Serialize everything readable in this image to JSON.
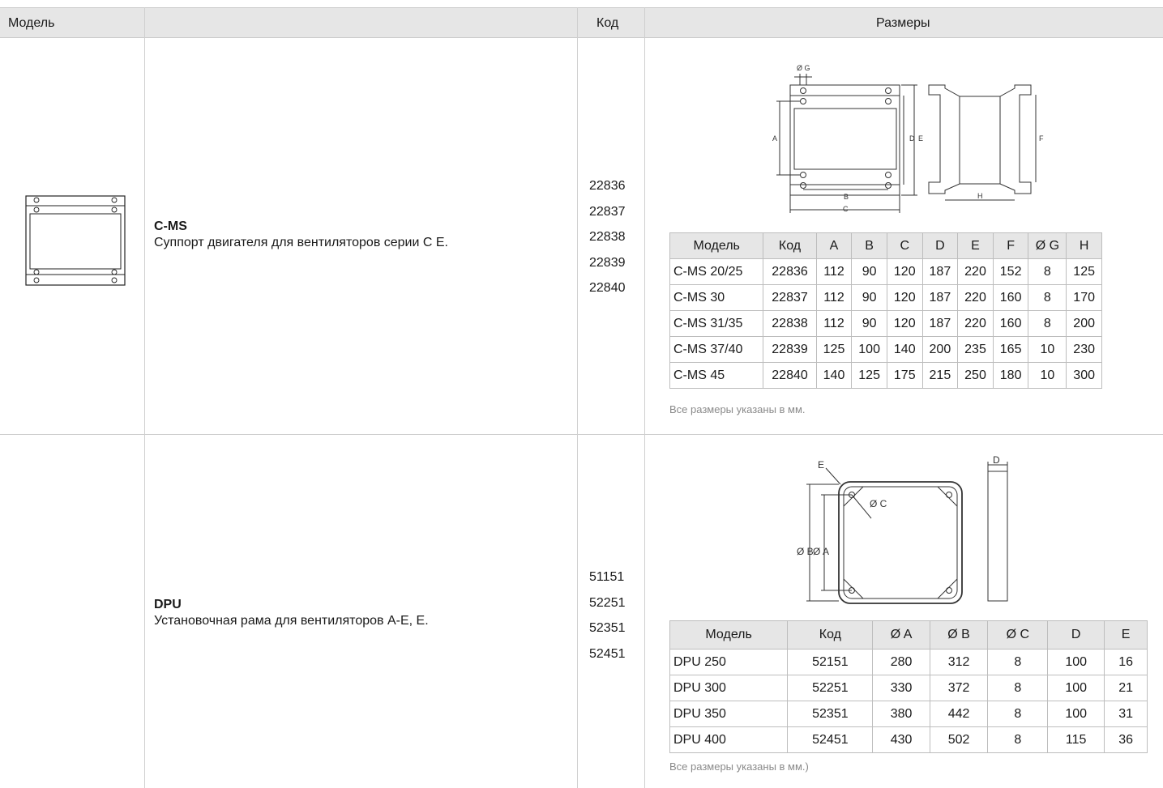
{
  "header": {
    "model": "Модель",
    "code": "Код",
    "dimensions": "Размеры"
  },
  "rows": [
    {
      "title": "C-MS",
      "description": "Суппорт двигателя для вентиляторов серии C E.",
      "codes": [
        "22836",
        "22837",
        "22838",
        "22839",
        "22840"
      ],
      "drawing_labels": {
        "g": "Ø G",
        "a": "A",
        "b": "B",
        "c": "C",
        "d": "D",
        "e": "E",
        "f": "F",
        "h": "H"
      },
      "table": {
        "headers": [
          "Модель",
          "Код",
          "A",
          "B",
          "C",
          "D",
          "E",
          "F",
          "Ø G",
          "H"
        ],
        "rows": [
          [
            "C-MS 20/25",
            "22836",
            "112",
            "90",
            "120",
            "187",
            "220",
            "152",
            "8",
            "125"
          ],
          [
            "C-MS 30",
            "22837",
            "112",
            "90",
            "120",
            "187",
            "220",
            "160",
            "8",
            "170"
          ],
          [
            "C-MS 31/35",
            "22838",
            "112",
            "90",
            "120",
            "187",
            "220",
            "160",
            "8",
            "200"
          ],
          [
            "C-MS 37/40",
            "22839",
            "125",
            "100",
            "140",
            "200",
            "235",
            "165",
            "10",
            "230"
          ],
          [
            "C-MS 45",
            "22840",
            "140",
            "125",
            "175",
            "215",
            "250",
            "180",
            "10",
            "300"
          ]
        ]
      },
      "note": "Все размеры указаны в мм."
    },
    {
      "title": "DPU",
      "description": "Установочная рама для вентиляторов A-E, E.",
      "codes": [
        "51151",
        "52251",
        "52351",
        "52451"
      ],
      "drawing_labels": {
        "e": "E",
        "c": "Ø C",
        "b": "Ø B",
        "a": "Ø A",
        "d": "D"
      },
      "table": {
        "headers": [
          "Модель",
          "Код",
          "Ø A",
          "Ø B",
          "Ø C",
          "D",
          "E"
        ],
        "rows": [
          [
            "DPU 250",
            "52151",
            "280",
            "312",
            "8",
            "100",
            "16"
          ],
          [
            "DPU 300",
            "52251",
            "330",
            "372",
            "8",
            "100",
            "21"
          ],
          [
            "DPU 350",
            "52351",
            "380",
            "442",
            "8",
            "100",
            "31"
          ],
          [
            "DPU 400",
            "52451",
            "430",
            "502",
            "8",
            "115",
            "36"
          ]
        ]
      },
      "note": "Все размеры указаны в мм.)"
    }
  ]
}
